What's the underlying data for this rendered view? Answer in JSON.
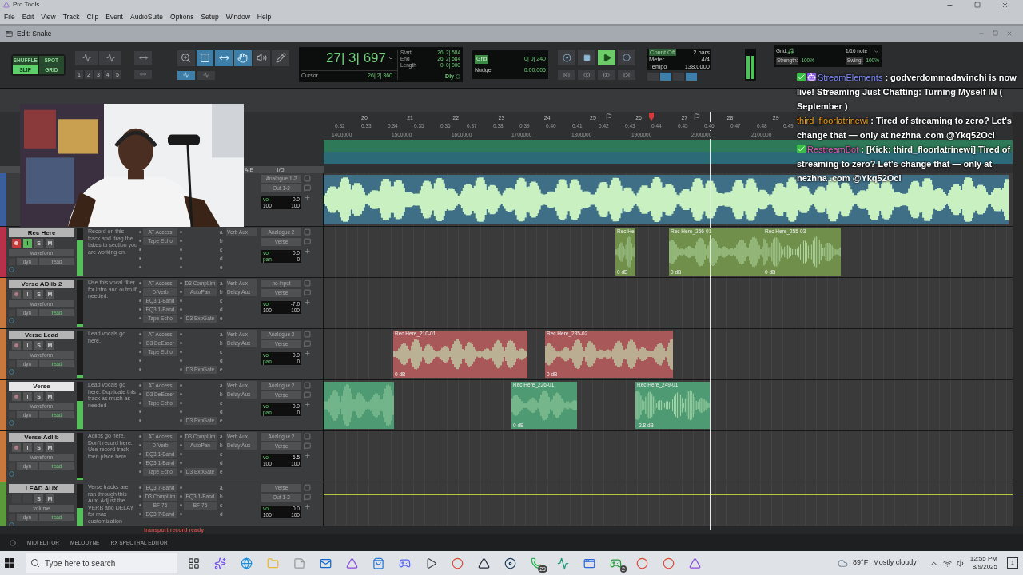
{
  "app": {
    "title": "Pro Tools"
  },
  "menu": [
    "File",
    "Edit",
    "View",
    "Track",
    "Clip",
    "Event",
    "AudioSuite",
    "Options",
    "Setup",
    "Window",
    "Help"
  ],
  "edit_window": {
    "title": "Edit: Snake"
  },
  "edit_modes": [
    {
      "label": "SHUFFLE",
      "selected": false
    },
    {
      "label": "SPOT",
      "selected": false
    },
    {
      "label": "SLIP",
      "selected": true
    },
    {
      "label": "GRID",
      "selected": false
    }
  ],
  "zoom_presets": [
    "1",
    "2",
    "3",
    "4",
    "5"
  ],
  "tools": [
    {
      "kind": "trim",
      "selected": true
    },
    {
      "kind": "selector",
      "selected": true
    },
    {
      "kind": "grabber",
      "selected": true
    },
    {
      "kind": "scrub",
      "selected": false
    },
    {
      "kind": "pencil",
      "selected": false
    }
  ],
  "counter": {
    "main": "27| 3| 697",
    "start_label": "Start",
    "start": "26| 2| 584",
    "end_label": "End",
    "end": "26| 2| 584",
    "length_label": "Length",
    "length": "0| 0| 000",
    "cursor_label": "Cursor",
    "cursor": "26| 2| 360",
    "delay": "Dly"
  },
  "grid_nudge": {
    "grid_label": "Grid",
    "grid": "0| 0| 240",
    "nudge_label": "Nudge",
    "nudge": "0:00.005"
  },
  "transport": [
    {
      "kind": "online",
      "selected": false
    },
    {
      "kind": "stop",
      "selected": false
    },
    {
      "kind": "play",
      "selected": true
    },
    {
      "kind": "record",
      "selected": false
    }
  ],
  "tempo_box": {
    "count_off": "Count Off",
    "count_value": "2 bars",
    "meter_label": "Meter",
    "meter": "4/4",
    "tempo_label": "Tempo",
    "tempo": "138.0000"
  },
  "groove": {
    "grid_label": "Grid:",
    "grid": "1/16 note",
    "strength_label": "Strength:",
    "strength": "100%",
    "swing_label": "Swing:",
    "swing": "100%"
  },
  "ruler": {
    "bars": [
      "20",
      "21",
      "22",
      "23",
      "24",
      "25",
      "26",
      "27",
      "28",
      "29"
    ],
    "times": [
      "0:32",
      "0:33",
      "0:34",
      "0:35",
      "0:36",
      "0:37",
      "0:38",
      "0:39",
      "0:40",
      "0:41",
      "0:42",
      "0:43",
      "0:44",
      "0:45",
      "0:46",
      "0:47",
      "0:48",
      "0:49"
    ],
    "samples": [
      "1400000",
      "1500000",
      "1600000",
      "1700000",
      "1800000",
      "1900000",
      "2000000",
      "2100000"
    ]
  },
  "columns": {
    "inserts": "A-E",
    "io": "I/O"
  },
  "tracks": [
    {
      "kind": "audio",
      "color": "#3b5f9c",
      "input_route": "Analogue 1-2",
      "output_route": "Out 1-2",
      "vol_label": "vol",
      "vol": "0.0",
      "pan": [
        "100",
        "100"
      ],
      "clips": [
        {
          "kind": "audio",
          "color": "#3f6f86"
        }
      ]
    },
    {
      "kind": "audio",
      "name": "Rec Here",
      "selected": false,
      "color": "#b8304a",
      "buttons": [
        {
          "kind": "record",
          "on": true
        },
        {
          "kind": "input",
          "label": "I",
          "on": true
        },
        {
          "kind": "solo",
          "label": "S",
          "on": false
        },
        {
          "kind": "mute",
          "label": "M",
          "on": false
        }
      ],
      "view": "waveform",
      "dyn": "dyn",
      "automation": "read",
      "automation_active": false,
      "meter": {
        "level": 0.75
      },
      "comment": "Record on this track and drag the takes to section you are working on.",
      "inserts_ae": [
        {
          "kind": "plugin",
          "name": "AT Access"
        },
        {
          "kind": "plugin",
          "name": "Tape Echo"
        },
        {
          "kind": "empty"
        },
        {
          "kind": "empty"
        },
        {
          "kind": "empty"
        }
      ],
      "inserts_fj": [
        {
          "kind": "empty"
        },
        {
          "kind": "empty"
        },
        {
          "kind": "empty"
        },
        {
          "kind": "empty"
        },
        {
          "kind": "empty"
        }
      ],
      "sends": [
        {
          "slot": "a",
          "name": "Verb Aux"
        },
        {
          "slot": "b"
        },
        {
          "slot": "c"
        },
        {
          "slot": "d"
        },
        {
          "slot": "e"
        }
      ],
      "input_route": "Analogue 2",
      "output_route": "Verse",
      "vol_label": "vol",
      "vol": "0.0",
      "pan_label": "pan",
      "pan": [
        "0"
      ],
      "clips": [
        {
          "kind": "audio",
          "name": "Rec He",
          "gain": "0 dB",
          "color": "#6f8f4a"
        },
        {
          "kind": "audio",
          "name": "Rec Here_256-01",
          "gain": "0 dB",
          "color": "#6f8f4a"
        },
        {
          "kind": "audio",
          "name": "Rec Here_255-03",
          "gain": "0 dB",
          "color": "#6f8f4a"
        }
      ]
    },
    {
      "kind": "audio",
      "name": "Verse ADlib 2",
      "selected": false,
      "color": "#c8783c",
      "buttons": [
        {
          "kind": "record",
          "on": false
        },
        {
          "kind": "input",
          "label": "I",
          "on": false
        },
        {
          "kind": "solo",
          "label": "S",
          "on": false
        },
        {
          "kind": "mute",
          "label": "M",
          "on": false
        }
      ],
      "view": "waveform",
      "dyn": "dyn",
      "automation": "read",
      "automation_active": true,
      "meter": {
        "level": 0.05
      },
      "comment": "Use this vocal filter for intro and outro if needed.",
      "inserts_ae": [
        {
          "kind": "plugin",
          "name": "AT Access"
        },
        {
          "kind": "plugin",
          "name": "D-Verb"
        },
        {
          "kind": "plugin",
          "name": "EQ3 1-Band"
        },
        {
          "kind": "plugin",
          "name": "EQ3 1-Band"
        },
        {
          "kind": "plugin",
          "name": "Tape Echo"
        }
      ],
      "inserts_fj": [
        {
          "kind": "plugin",
          "name": "D3 CompLim"
        },
        {
          "kind": "plugin",
          "name": "AutoPan"
        },
        {
          "kind": "empty"
        },
        {
          "kind": "empty"
        },
        {
          "kind": "plugin",
          "name": "D3 ExpGate"
        }
      ],
      "sends": [
        {
          "slot": "a",
          "name": "Verb Aux"
        },
        {
          "slot": "b",
          "name": "Delay Aux"
        },
        {
          "slot": "c"
        },
        {
          "slot": "d"
        },
        {
          "slot": "e"
        }
      ],
      "input_route": "no input",
      "output_route": "Verse",
      "vol_label": "vol",
      "vol": "-7.0",
      "pan": [
        "100",
        "100"
      ]
    },
    {
      "kind": "audio",
      "name": "Verse Lead",
      "selected": false,
      "color": "#c8783c",
      "buttons": [
        {
          "kind": "record",
          "on": false
        },
        {
          "kind": "input",
          "label": "I",
          "on": false
        },
        {
          "kind": "solo",
          "label": "S",
          "on": false
        },
        {
          "kind": "mute",
          "label": "M",
          "on": false
        }
      ],
      "view": "waveform",
      "dyn": "dyn",
      "automation": "read",
      "automation_active": true,
      "meter": {
        "level": 0.05
      },
      "comment": "Lead vocals go here.",
      "inserts_ae": [
        {
          "kind": "plugin",
          "name": "AT Access"
        },
        {
          "kind": "plugin",
          "name": "D3 DeEsser"
        },
        {
          "kind": "plugin",
          "name": "Tape Echo"
        },
        {
          "kind": "empty"
        },
        {
          "kind": "empty"
        }
      ],
      "inserts_fj": [
        {
          "kind": "empty"
        },
        {
          "kind": "empty"
        },
        {
          "kind": "empty"
        },
        {
          "kind": "empty"
        },
        {
          "kind": "plugin",
          "name": "D3 ExpGate"
        }
      ],
      "sends": [
        {
          "slot": "a",
          "name": "Verb Aux"
        },
        {
          "slot": "b",
          "name": "Delay Aux"
        },
        {
          "slot": "c"
        },
        {
          "slot": "d"
        },
        {
          "slot": "e"
        }
      ],
      "input_route": "Analogue 2",
      "output_route": "Verse",
      "vol_label": "vol",
      "vol": "0.0",
      "pan_label": "pan",
      "pan": [
        "0"
      ],
      "clips": [
        {
          "kind": "audio",
          "name": "Rec Here_210-01",
          "gain": "0 dB",
          "color": "#a85858"
        },
        {
          "kind": "audio",
          "name": "Rec Here_235-02",
          "gain": "0 dB",
          "color": "#a85858"
        }
      ]
    },
    {
      "kind": "audio",
      "name": "Verse",
      "selected": true,
      "color": "#c8783c",
      "buttons": [
        {
          "kind": "record",
          "on": false
        },
        {
          "kind": "input",
          "label": "I",
          "on": false
        },
        {
          "kind": "solo",
          "label": "S",
          "on": false
        },
        {
          "kind": "mute",
          "label": "M",
          "on": false
        }
      ],
      "view": "waveform",
      "dyn": "dyn",
      "automation": "read",
      "automation_active": true,
      "meter": {
        "level": 0.6
      },
      "comment": "Lead vocals go here. Duplicate this track as much as needed",
      "inserts_ae": [
        {
          "kind": "plugin",
          "name": "AT Access"
        },
        {
          "kind": "plugin",
          "name": "D3 DeEsser"
        },
        {
          "kind": "plugin",
          "name": "Tape Echo"
        },
        {
          "kind": "empty"
        },
        {
          "kind": "empty"
        }
      ],
      "inserts_fj": [
        {
          "kind": "empty"
        },
        {
          "kind": "empty"
        },
        {
          "kind": "empty"
        },
        {
          "kind": "empty"
        },
        {
          "kind": "plugin",
          "name": "D3 ExpGate"
        }
      ],
      "sends": [
        {
          "slot": "a",
          "name": "Verb Aux"
        },
        {
          "slot": "b",
          "name": "Delay Aux"
        },
        {
          "slot": "c"
        },
        {
          "slot": "d"
        },
        {
          "slot": "e"
        }
      ],
      "input_route": "Analogue 2",
      "output_route": "Verse",
      "vol_label": "vol",
      "vol": "0.0",
      "pan_label": "pan",
      "pan": [
        "0"
      ],
      "clips": [
        {
          "kind": "audio",
          "color": "#4e9a72"
        },
        {
          "kind": "audio",
          "name": "Rec Here_226-01",
          "gain": "0 dB",
          "color": "#4e9a72"
        },
        {
          "kind": "audio",
          "name": "Rec Here_249-01",
          "gain": "-2.8 dB",
          "color": "#4e9a72"
        }
      ]
    },
    {
      "kind": "audio",
      "name": "Verse Adlib",
      "selected": false,
      "color": "#c8783c",
      "buttons": [
        {
          "kind": "record",
          "on": false
        },
        {
          "kind": "input",
          "label": "I",
          "on": false
        },
        {
          "kind": "solo",
          "label": "S",
          "on": false
        },
        {
          "kind": "mute",
          "label": "M",
          "on": false
        }
      ],
      "view": "waveform",
      "dyn": "dyn",
      "automation": "read",
      "automation_active": true,
      "meter": {
        "level": 0.05
      },
      "comment": "Adlibs go here. Don't record here. Use record track then place here.",
      "inserts_ae": [
        {
          "kind": "plugin",
          "name": "AT Access"
        },
        {
          "kind": "plugin",
          "name": "D-Verb"
        },
        {
          "kind": "plugin",
          "name": "EQ3 1-Band"
        },
        {
          "kind": "plugin",
          "name": "EQ3 1-Band"
        },
        {
          "kind": "plugin",
          "name": "Tape Echo"
        }
      ],
      "inserts_fj": [
        {
          "kind": "plugin",
          "name": "D3 CompLim"
        },
        {
          "kind": "plugin",
          "name": "AutoPan"
        },
        {
          "kind": "empty"
        },
        {
          "kind": "empty"
        },
        {
          "kind": "plugin",
          "name": "D3 ExpGate"
        }
      ],
      "sends": [
        {
          "slot": "a",
          "name": "Verb Aux"
        },
        {
          "slot": "b",
          "name": "Delay Aux"
        },
        {
          "slot": "c"
        },
        {
          "slot": "d"
        },
        {
          "slot": "e"
        }
      ],
      "input_route": "Analogue 2",
      "output_route": "Verse",
      "vol_label": "vol",
      "vol": "-6.5",
      "pan": [
        "100",
        "100"
      ]
    },
    {
      "kind": "aux",
      "name": "LEAD AUX",
      "selected": false,
      "color": "#5a9a3a",
      "buttons": [
        {
          "kind": "solo",
          "label": "S",
          "on": false
        },
        {
          "kind": "mute",
          "label": "M",
          "on": false
        }
      ],
      "view": "volume",
      "dyn": "dyn",
      "automation": "read",
      "automation_active": true,
      "meter": {
        "level": 0.5
      },
      "comment": "Verse tracks are ran through this Aux. Adjust the VERB and DELAY for max customization",
      "inserts_ae": [
        {
          "kind": "plugin",
          "name": "EQ3 7-Band"
        },
        {
          "kind": "plugin",
          "name": "D3 CompLim"
        },
        {
          "kind": "plugin",
          "name": "BF-76"
        },
        {
          "kind": "plugin",
          "name": "EQ3 7-Band"
        }
      ],
      "inserts_fj": [
        {
          "kind": "empty"
        },
        {
          "kind": "plugin",
          "name": "EQ3 1-Band"
        },
        {
          "kind": "plugin",
          "name": "BF-76"
        },
        {
          "kind": "empty"
        }
      ],
      "sends": [
        {
          "slot": "a"
        },
        {
          "slot": "b"
        },
        {
          "slot": "c"
        },
        {
          "slot": "d"
        }
      ],
      "input_route": "Verse",
      "output_route": "Out 1-2",
      "vol_label": "vol",
      "vol": "0.0",
      "pan": [
        "100",
        "100"
      ]
    }
  ],
  "status": "transport record ready",
  "bottom_tabs": [
    "MIDI EDITOR",
    "MELODYNE",
    "RX SPECTRAL EDITOR"
  ],
  "chat": [
    {
      "user": "StreamElements",
      "color": "#7d8cff",
      "badges": [
        {
          "kind": "verified"
        },
        {
          "kind": "bot"
        }
      ],
      "text": ": godverdommadavinchi is now live! Streaming Just Chatting: Turning Myself IN ( September )"
    },
    {
      "user": "third_floorlatrinewi",
      "color": "#f0a020",
      "text": ": Tired of streaming to zero? Let's change that — only at nezhna .com @Ykq52Ocl"
    },
    {
      "user": "RestreamBot",
      "color": "#e858c0",
      "badges": [
        {
          "kind": "verified"
        }
      ],
      "text": ": [Kick: third_floorlatrinewi] Tired of streaming to zero? Let's change that — only at nezhna .com @Ykq52Ocl"
    }
  ],
  "taskbar": {
    "search_placeholder": "Type here to search",
    "apps": [
      {
        "kind": "taskview"
      },
      {
        "kind": "copilot"
      },
      {
        "kind": "edge"
      },
      {
        "kind": "folder"
      },
      {
        "kind": "notes"
      },
      {
        "kind": "outlook"
      },
      {
        "kind": "protools"
      },
      {
        "kind": "store"
      },
      {
        "kind": "discord"
      },
      {
        "kind": "player"
      },
      {
        "kind": "chrome"
      },
      {
        "kind": "adobe"
      },
      {
        "kind": "steam"
      },
      {
        "kind": "whatsapp",
        "badge": "29"
      },
      {
        "kind": "chart"
      },
      {
        "kind": "window"
      },
      {
        "kind": "xbox",
        "badge": "2"
      },
      {
        "kind": "chrome"
      },
      {
        "kind": "chrome"
      },
      {
        "kind": "protools"
      }
    ],
    "temperature": "89°F",
    "weather": "Mostly cloudy",
    "time": "12:55 PM",
    "date": "8/9/2025",
    "notifications": "1"
  }
}
